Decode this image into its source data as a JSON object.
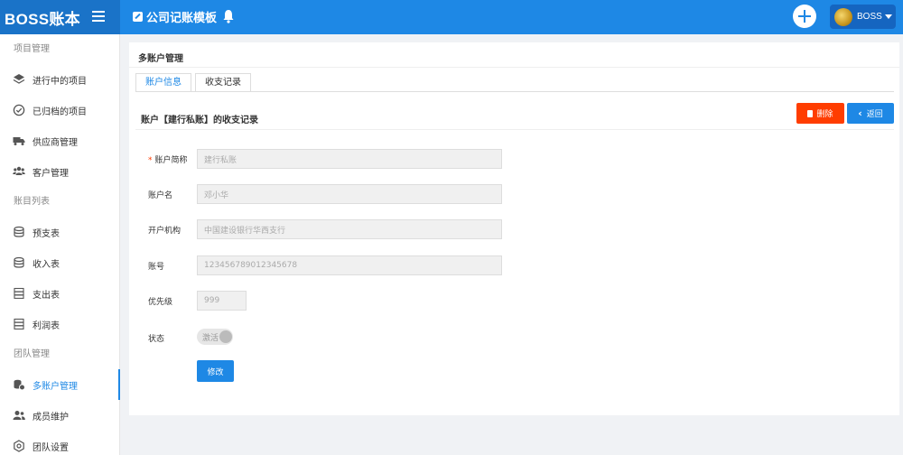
{
  "header": {
    "brand": "BOSS账本",
    "title": "公司记账模板",
    "user_name": "BOSS"
  },
  "sidebar": {
    "groups": [
      {
        "title": "项目管理",
        "items": [
          {
            "label": "进行中的项目",
            "icon": "layers-icon"
          },
          {
            "label": "已归档的项目",
            "icon": "check-circle-icon"
          },
          {
            "label": "供应商管理",
            "icon": "truck-icon"
          },
          {
            "label": "客户管理",
            "icon": "users-icon"
          }
        ]
      },
      {
        "title": "账目列表",
        "items": [
          {
            "label": "预支表",
            "icon": "database-icon"
          },
          {
            "label": "收入表",
            "icon": "database-icon"
          },
          {
            "label": "支出表",
            "icon": "server-icon"
          },
          {
            "label": "利润表",
            "icon": "server-icon"
          }
        ]
      },
      {
        "title": "团队管理",
        "items": [
          {
            "label": "多账户管理",
            "icon": "accounts-icon",
            "active": true
          },
          {
            "label": "成员维护",
            "icon": "member-icon"
          },
          {
            "label": "团队设置",
            "icon": "settings-icon"
          }
        ]
      }
    ]
  },
  "main": {
    "panel_title": "多账户管理",
    "tabs": [
      {
        "label": "账户信息",
        "active": true
      },
      {
        "label": "收支记录",
        "active": false
      }
    ],
    "section_title": "账户【建行私账】的收支记录",
    "buttons": {
      "delete": "删除",
      "back": "返回",
      "edit": "修改"
    },
    "form": {
      "short_name": {
        "label": "账户简称",
        "value": "建行私账",
        "required": true
      },
      "account_name": {
        "label": "账户名",
        "value": "邓小华"
      },
      "institution": {
        "label": "开户机构",
        "value": "中国建设银行华西支行"
      },
      "account_no": {
        "label": "账号",
        "value": "123456789012345678"
      },
      "priority": {
        "label": "优先级",
        "value": "999"
      },
      "status": {
        "label": "状态",
        "value": "激活"
      }
    }
  },
  "colors": {
    "primary": "#1e88e5",
    "brand_bg": "#1a73c8",
    "danger": "#ff3d00"
  }
}
